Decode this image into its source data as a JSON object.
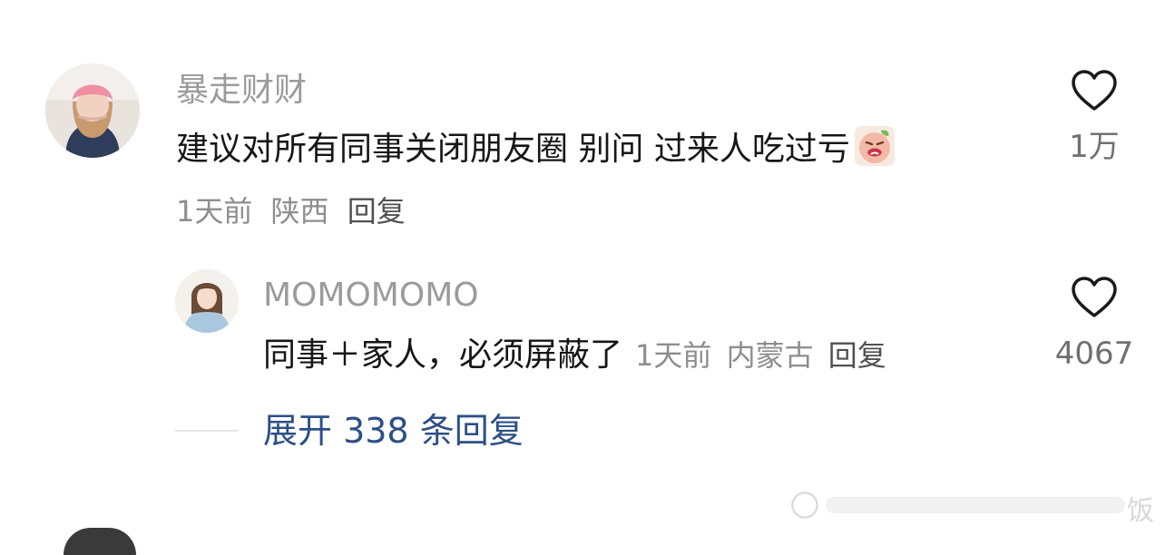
{
  "comments": [
    {
      "username": "暴走财财",
      "text": "建议对所有同事关闭朋友圈 别问 过来人吃过亏",
      "emoji_icon": "crying-peach-emoji-icon",
      "time": "1天前",
      "location": "陕西",
      "reply_label": "回复",
      "likes": "1万",
      "avatar_icon": "user-avatar-pink-beanie"
    }
  ],
  "reply": {
    "username": "MOMOMOMO",
    "text": "同事＋家人，必须屏蔽了",
    "time": "1天前",
    "location": "内蒙古",
    "reply_label": "回复",
    "likes": "4067",
    "avatar_icon": "user-avatar-illustrated-woman"
  },
  "expand": {
    "label": "展开 338 条回复"
  },
  "watermark": {
    "text": "饭"
  },
  "colors": {
    "username": "#9b9b9b",
    "content": "#161616",
    "meta": "#8e8e8e",
    "expand_link": "#2c4f86",
    "heart_stroke": "#1a1a1a"
  }
}
